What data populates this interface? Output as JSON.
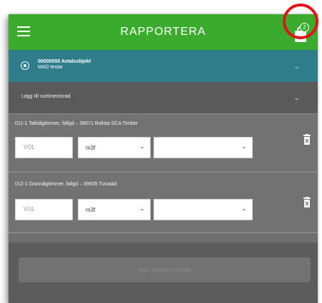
{
  "header": {
    "title": "RAPPORTERA",
    "basket_count": "2",
    "accent_color": "#3bab2e",
    "highlight_color": "#e3131a"
  },
  "contract_object": {
    "title": "00000050 Avtalsobjekt",
    "subtitle": "MAD testar",
    "color": "#2f7c8b"
  },
  "add_row": {
    "label": "Lägg till sortimentsrad"
  },
  "items": [
    {
      "label": "011-1 Tallsågtimmer, fallgd – 39071 Bollsta SCA Timber",
      "volume_placeholder": "VOL",
      "unit": "m3f",
      "option": ""
    },
    {
      "label": "012-1 Gransågtimmer, fallgd – 39605 Tunadal",
      "volume_placeholder": "VOL",
      "unit": "m3f",
      "option": ""
    }
  ],
  "footer": {
    "button_label": "Inga sortiment ifyllda"
  },
  "icons": [
    "menu-icon",
    "basket-icon",
    "radio-icon",
    "chevron-down-icon",
    "trash-icon"
  ]
}
